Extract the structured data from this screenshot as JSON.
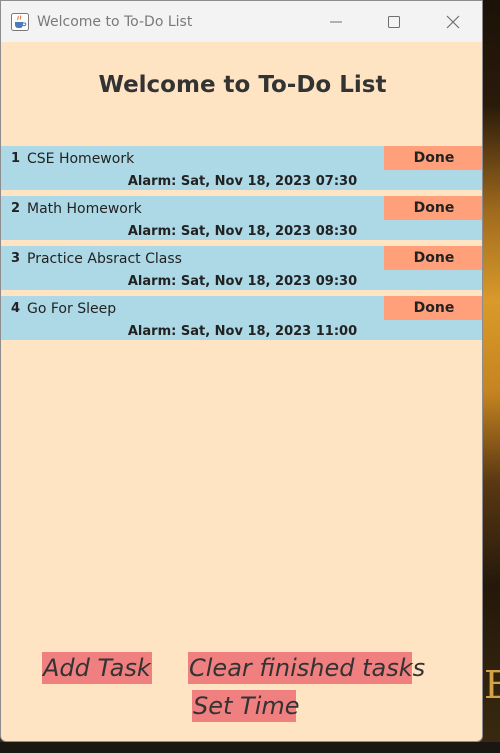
{
  "window": {
    "title": "Welcome to To-Do List"
  },
  "heading": "Welcome to To-Do List",
  "tasks": [
    {
      "number": "1",
      "name": "CSE Homework",
      "done_label": "Done",
      "alarm": "Alarm: Sat, Nov 18, 2023 07:30"
    },
    {
      "number": "2",
      "name": "Math Homework",
      "done_label": "Done",
      "alarm": "Alarm: Sat, Nov 18, 2023 08:30"
    },
    {
      "number": "3",
      "name": "Practice Absract Class",
      "done_label": "Done",
      "alarm": "Alarm: Sat, Nov 18, 2023 09:30"
    },
    {
      "number": "4",
      "name": "Go For Sleep",
      "done_label": "Done",
      "alarm": "Alarm: Sat, Nov 18, 2023 11:00"
    }
  ],
  "actions": {
    "add_task": "Add Task",
    "clear_finished": "Clear finished tasks",
    "set_time": "Set Time"
  },
  "background": {
    "glyph": "E"
  },
  "colors": {
    "window_bg": "#ffe4c4",
    "task_bg": "#add8e6",
    "done_button": "#ffa07a",
    "action_button": "#f08080"
  },
  "icons": {
    "app": "java-cup-icon",
    "minimize": "minimize-icon",
    "maximize": "maximize-icon",
    "close": "close-icon"
  }
}
